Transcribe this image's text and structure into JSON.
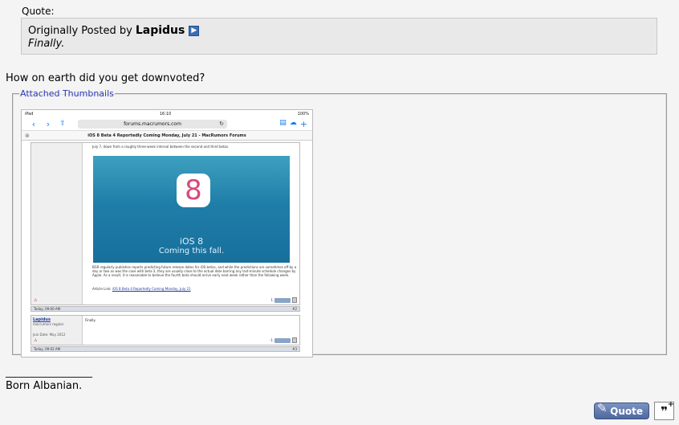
{
  "quote": {
    "label": "Quote:",
    "originally_posted_by": "Originally Posted by",
    "author": "Lapidus",
    "text": "Finally."
  },
  "reply": {
    "text": "How on earth did you get downvoted?"
  },
  "attachments": {
    "legend": "Attached Thumbnails",
    "thumbnail": {
      "status_left": "iPad",
      "status_time": "16:10",
      "status_battery": "100%",
      "url": "forums.macrumors.com",
      "tab_title": "iOS 8 Beta 4 Reportedly Coming Monday, July 21 - MacRumors Forums",
      "snippet": "July 7, down from a roughly three-week interval between the second and third betas.",
      "icon_glyph": "8",
      "banner_line1": "iOS 8",
      "banner_line2": "Coming this fall.",
      "body": "BGR regularly publishes reports predicting future release dates for iOS betas, and while the predictions are sometimes off by a day or two as was the case with beta 3, they are usually close to the actual date barring any last-minute schedule changes by Apple. As a result, it is reasonable to believe the fourth beta should arrive early next week rather than the following week.",
      "article_link_label": "Article Link:",
      "article_link": "iOS 8 Beta 4 Reportedly Coming Monday, July 21",
      "post1_count": "1",
      "date1": "Today, 09:00 AM",
      "post2_num": "#2",
      "post2_user": "Lapidus",
      "post2_rank": "macrumors regular",
      "post2_join": "Join Date: May 2012",
      "post2_text": "Finally.",
      "post2_count": "-1",
      "date2": "Today, 09:02 AM",
      "post3_num": "#3"
    }
  },
  "signature": {
    "line": "__________________",
    "text": "Born Albanian."
  },
  "buttons": {
    "quote_label": "Quote",
    "multiquote_glyph": "❞"
  }
}
